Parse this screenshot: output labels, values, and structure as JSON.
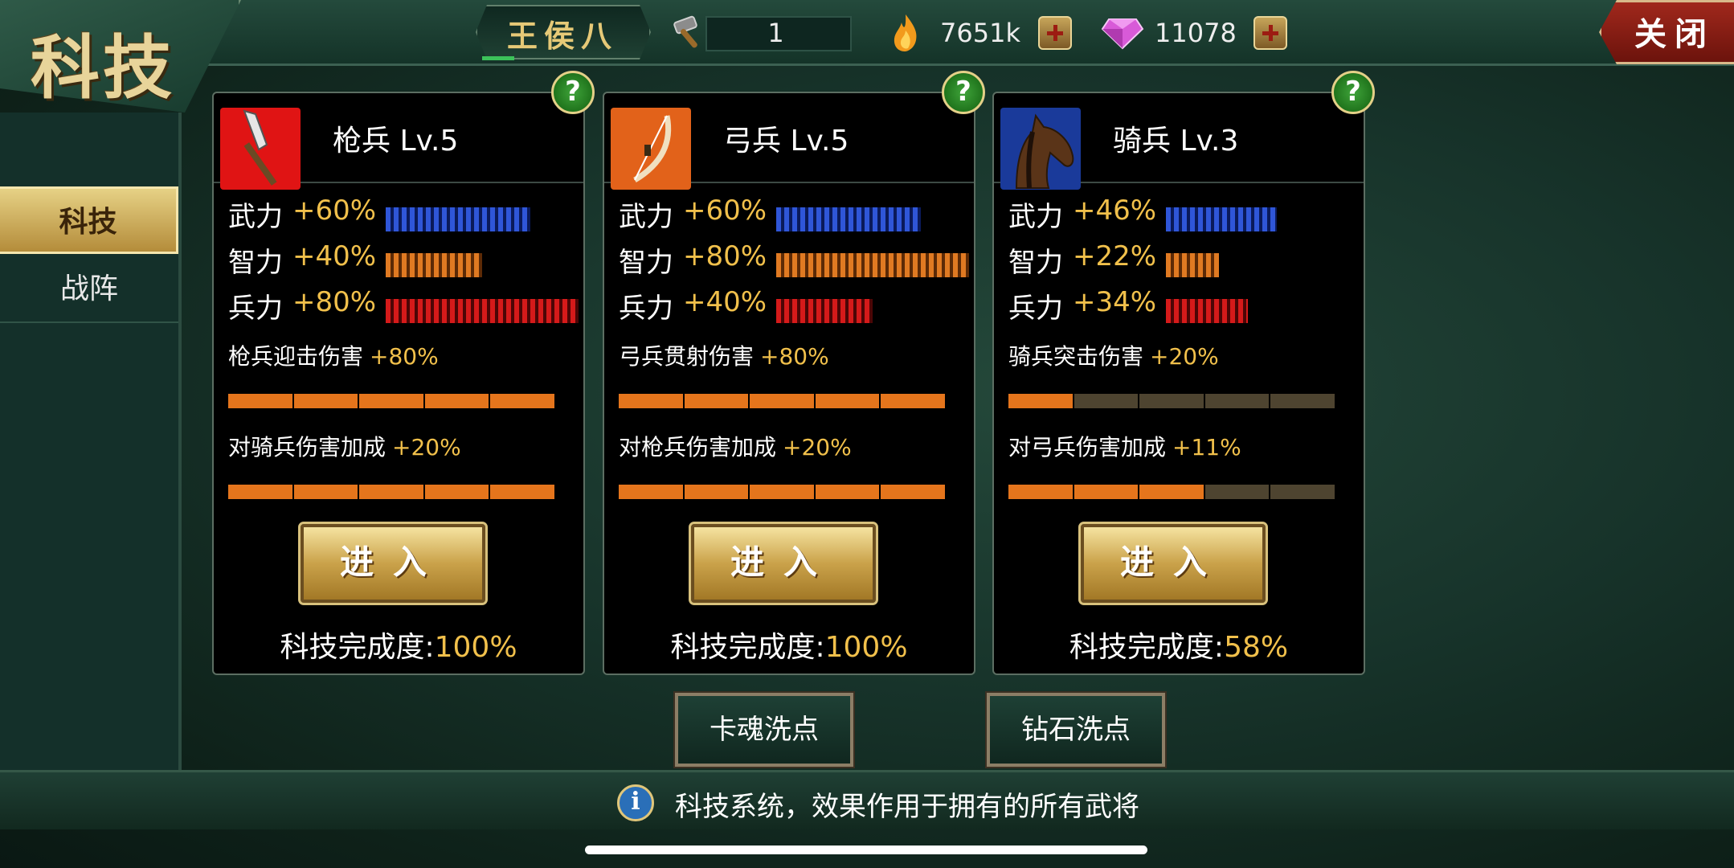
{
  "header": {
    "title": "科技",
    "player_name": "王侯八",
    "hammer_count": "1",
    "fire_amount": "7651k",
    "gem_amount": "11078",
    "close_label": "关闭"
  },
  "sidebar": {
    "items": [
      {
        "label": "科技",
        "active": true
      },
      {
        "label": "战阵",
        "active": false
      }
    ]
  },
  "cards": [
    {
      "title": "枪兵 Lv.5",
      "icon": "spear-icon",
      "icon_color": "#e01414",
      "stats": [
        {
          "name": "武力",
          "value": "+60%",
          "color": "blue",
          "level": 60
        },
        {
          "name": "智力",
          "value": "+40%",
          "color": "orange",
          "level": 40
        },
        {
          "name": "兵力",
          "value": "+80%",
          "color": "red",
          "level": 80
        }
      ],
      "bonuses": [
        {
          "label": "枪兵迎击伤害",
          "value": "+80%",
          "filled": 5,
          "total": 5
        },
        {
          "label": "对骑兵伤害加成",
          "value": "+20%",
          "filled": 5,
          "total": 5
        }
      ],
      "enter_label": "进入",
      "completion_label": "科技完成度:",
      "completion_value": "100%"
    },
    {
      "title": "弓兵 Lv.5",
      "icon": "bow-icon",
      "icon_color": "#e2621a",
      "stats": [
        {
          "name": "武力",
          "value": "+60%",
          "color": "blue",
          "level": 60
        },
        {
          "name": "智力",
          "value": "+80%",
          "color": "orange",
          "level": 80
        },
        {
          "name": "兵力",
          "value": "+40%",
          "color": "red",
          "level": 40
        }
      ],
      "bonuses": [
        {
          "label": "弓兵贯射伤害",
          "value": "+80%",
          "filled": 5,
          "total": 5
        },
        {
          "label": "对枪兵伤害加成",
          "value": "+20%",
          "filled": 5,
          "total": 5
        }
      ],
      "enter_label": "进入",
      "completion_label": "科技完成度:",
      "completion_value": "100%"
    },
    {
      "title": "骑兵 Lv.3",
      "icon": "horse-icon",
      "icon_color": "#1a3a9a",
      "stats": [
        {
          "name": "武力",
          "value": "+46%",
          "color": "blue",
          "level": 46
        },
        {
          "name": "智力",
          "value": "+22%",
          "color": "orange",
          "level": 22
        },
        {
          "name": "兵力",
          "value": "+34%",
          "color": "red",
          "level": 34
        }
      ],
      "bonuses": [
        {
          "label": "骑兵突击伤害",
          "value": "+20%",
          "filled": 1,
          "total": 5
        },
        {
          "label": "对弓兵伤害加成",
          "value": "+11%",
          "filled": 3,
          "total": 5
        }
      ],
      "enter_label": "进入",
      "completion_label": "科技完成度:",
      "completion_value": "58%"
    }
  ],
  "buttons": {
    "card_soul_reset": "卡魂洗点",
    "diamond_reset": "钻石洗点"
  },
  "footer": {
    "info_text": "科技系统，效果作用于拥有的所有武将"
  }
}
